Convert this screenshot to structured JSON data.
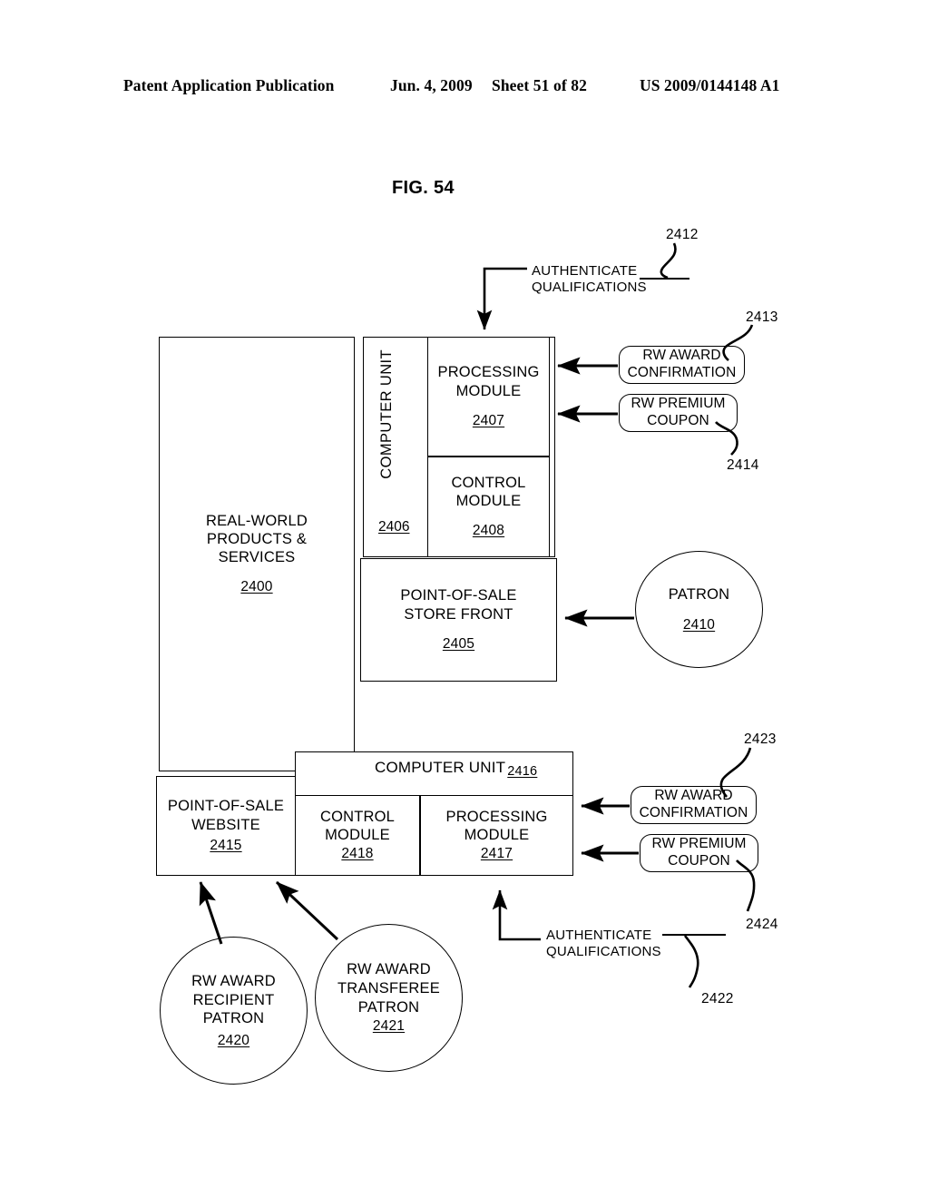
{
  "header": {
    "publication": "Patent Application Publication",
    "date": "Jun. 4, 2009",
    "sheet": "Sheet 51 of 82",
    "patent_number": "US 2009/0144148 A1"
  },
  "figure": {
    "label": "FIG. 54"
  },
  "diagram": {
    "top": {
      "authenticate_label_line1": "AUTHENTICATE",
      "authenticate_label_line2": "QUALIFICATIONS",
      "authenticate_ref": "2412",
      "real_world": {
        "line1": "REAL-WORLD",
        "line2": "PRODUCTS &",
        "line3": "SERVICES",
        "ref": "2400"
      },
      "computer_unit": {
        "label": "COMPUTER UNIT",
        "ref": "2406"
      },
      "processing_module": {
        "line1": "PROCESSING",
        "line2": "MODULE",
        "ref": "2407"
      },
      "control_module": {
        "line1": "CONTROL",
        "line2": "MODULE",
        "ref": "2408"
      },
      "pos_store_front": {
        "line1": "POINT-OF-SALE",
        "line2": "STORE FRONT",
        "ref": "2405"
      },
      "rw_award_confirmation": {
        "line1": "RW AWARD",
        "line2": "CONFIRMATION",
        "ref": "2413"
      },
      "rw_premium_coupon": {
        "line1": "RW PREMIUM",
        "line2": "COUPON",
        "ref": "2414"
      },
      "patron": {
        "label": "PATRON",
        "ref": "2410"
      }
    },
    "bottom": {
      "pos_website": {
        "line1": "POINT-OF-SALE",
        "line2": "WEBSITE",
        "ref": "2415"
      },
      "computer_unit": {
        "label": "COMPUTER UNIT",
        "ref": "2416"
      },
      "control_module": {
        "line1": "CONTROL",
        "line2": "MODULE",
        "ref": "2418"
      },
      "processing_module": {
        "line1": "PROCESSING",
        "line2": "MODULE",
        "ref": "2417"
      },
      "rw_award_confirmation": {
        "line1": "RW AWARD",
        "line2": "CONFIRMATION",
        "ref": "2423"
      },
      "rw_premium_coupon": {
        "line1": "RW PREMIUM",
        "line2": "COUPON",
        "ref": "2424"
      },
      "authenticate_label_line1": "AUTHENTICATE",
      "authenticate_label_line2": "QUALIFICATIONS",
      "authenticate_ref": "2422",
      "recipient_patron": {
        "line1": "RW AWARD",
        "line2": "RECIPIENT",
        "line3": "PATRON",
        "ref": "2420"
      },
      "transferee_patron": {
        "line1": "RW AWARD",
        "line2": "TRANSFEREE",
        "line3": "PATRON",
        "ref": "2421"
      }
    }
  }
}
